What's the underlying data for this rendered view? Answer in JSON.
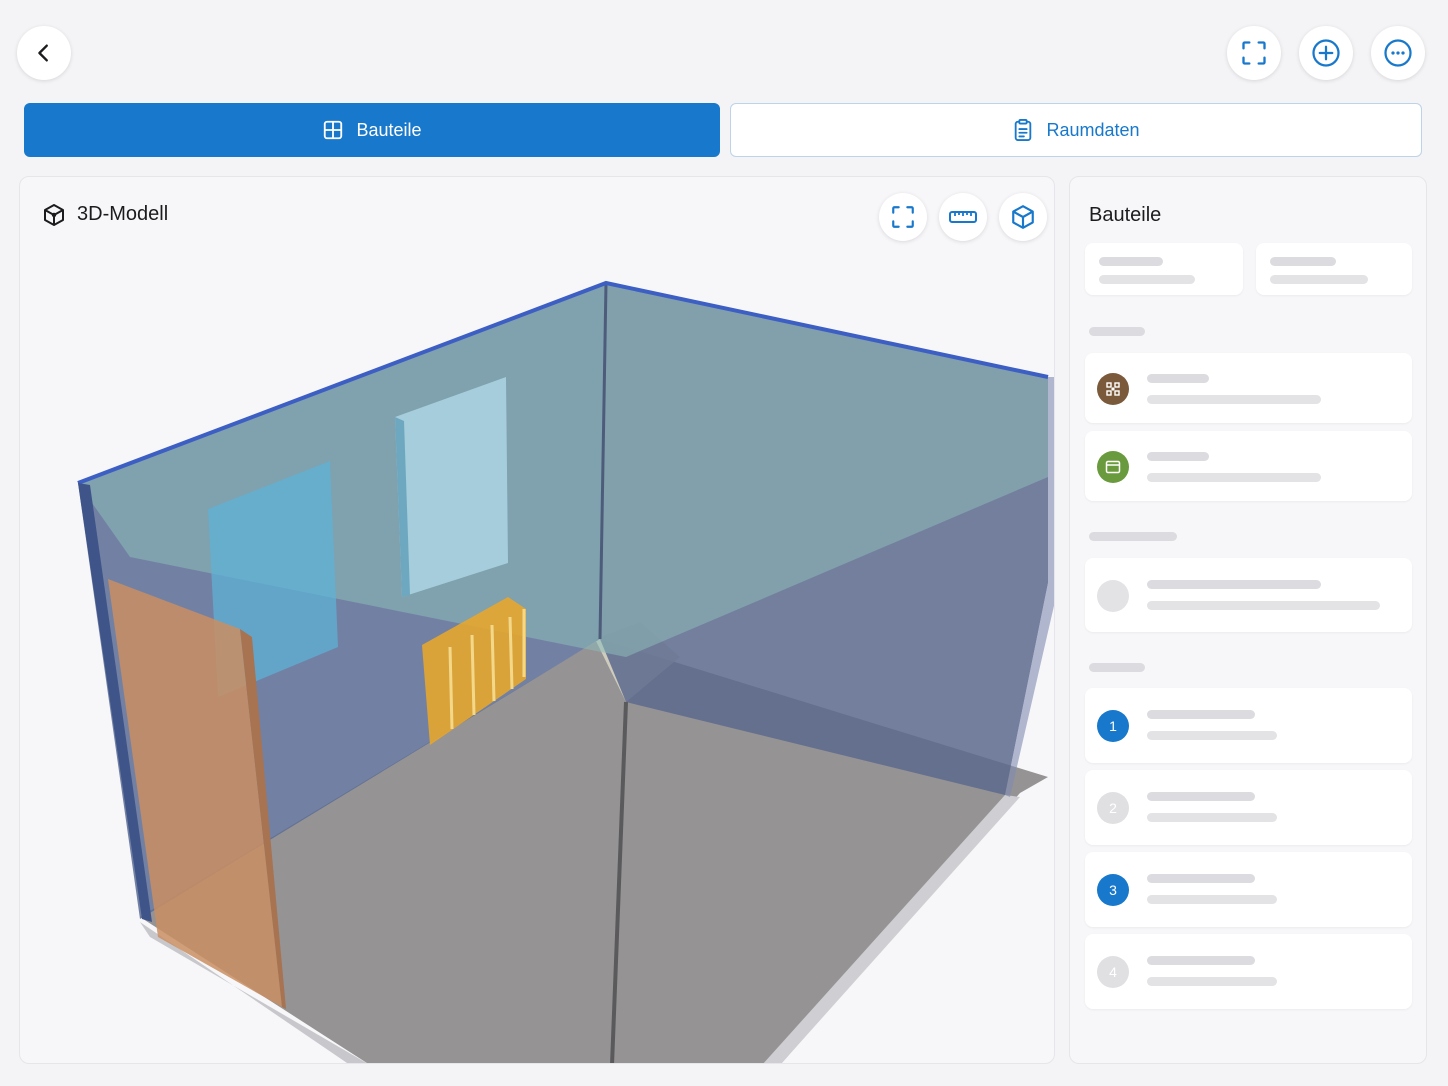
{
  "tabs": {
    "components_label": "Bauteile",
    "roomdata_label": "Raumdaten"
  },
  "viewer": {
    "title": "3D-Modell"
  },
  "sidebar": {
    "title": "Bauteile",
    "steps": [
      "1",
      "2",
      "3",
      "4"
    ]
  },
  "icons": {
    "back": "chevron-left-icon",
    "fullscreen": "fullscreen-icon",
    "add": "plus-circle-icon",
    "more": "more-circle-icon",
    "grid": "grid-icon",
    "clipboard": "clipboard-icon",
    "model": "cube-3d-icon",
    "ruler": "ruler-icon",
    "cube": "cube-icon"
  },
  "colors": {
    "accent": "#1778cc",
    "brown_badge": "#7b5a3c",
    "green_badge": "#6a9a3e"
  }
}
